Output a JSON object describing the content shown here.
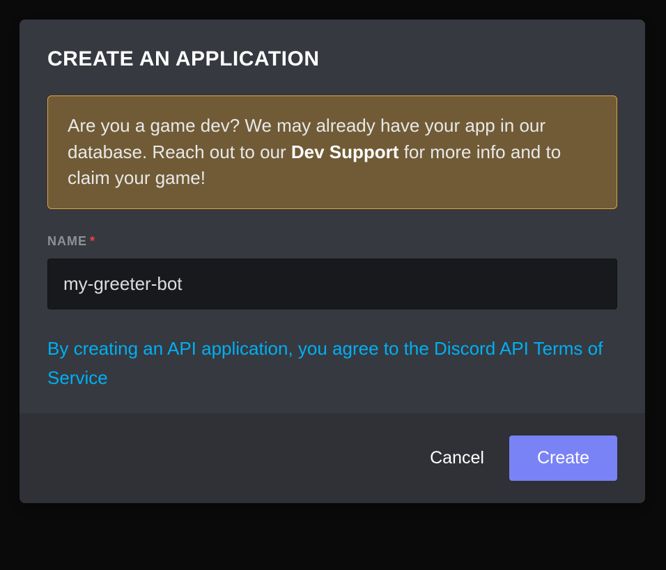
{
  "modal": {
    "title": "CREATE AN APPLICATION",
    "notice": {
      "prefix": "Are you a game dev? We may already have your app in our database. Reach out to our ",
      "link_text": "Dev Support",
      "suffix": " for more info and to claim your game!"
    },
    "name_field": {
      "label": "NAME",
      "required_mark": "*",
      "value": "my-greeter-bot"
    },
    "tos_text": "By creating an API application, you agree to the Discord API Terms of Service",
    "footer": {
      "cancel_label": "Cancel",
      "create_label": "Create"
    }
  }
}
